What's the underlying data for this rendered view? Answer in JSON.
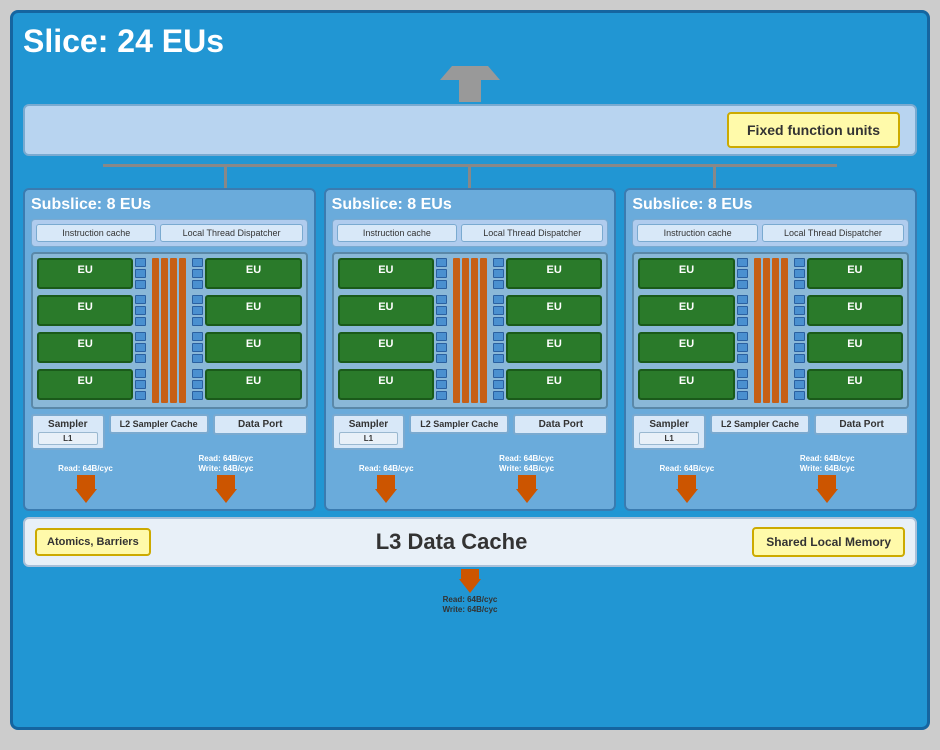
{
  "title": "Slice: 24 EUs",
  "fixed_function_units": "Fixed function units",
  "subslices": [
    {
      "title": "Subslice: 8 EUs",
      "instr_cache": "Instruction cache",
      "thread_dispatcher": "Local Thread Dispatcher",
      "eu_label": "EU",
      "sampler": "Sampler",
      "sampler_l1": "L1",
      "l2_sampler": "L2 Sampler Cache",
      "data_port": "Data Port",
      "bw_read1": "Read: 64B/cyc",
      "bw_read2": "Read: 64B/cyc",
      "bw_write2": "Write: 64B/cyc"
    },
    {
      "title": "Subslice: 8 EUs",
      "instr_cache": "Instruction cache",
      "thread_dispatcher": "Local Thread Dispatcher",
      "eu_label": "EU",
      "sampler": "Sampler",
      "sampler_l1": "L1",
      "l2_sampler": "L2 Sampler Cache",
      "data_port": "Data Port",
      "bw_read1": "Read: 64B/cyc",
      "bw_read2": "Read: 64B/cyc",
      "bw_write2": "Write: 64B/cyc"
    },
    {
      "title": "Subslice: 8 EUs",
      "instr_cache": "Instruction cache",
      "thread_dispatcher": "Local Thread Dispatcher",
      "eu_label": "EU",
      "sampler": "Sampler",
      "sampler_l1": "L1",
      "l2_sampler": "L2 Sampler Cache",
      "data_port": "Data Port",
      "bw_read1": "Read: 64B/cyc",
      "bw_read2": "Read: 64B/cyc",
      "bw_write2": "Write: 64B/cyc"
    }
  ],
  "l3_label": "L3 Data Cache",
  "atomics_label": "Atomics, Barriers",
  "slm_label": "Shared Local Memory",
  "bottom_bw_read": "Read: 64B/cyc",
  "bottom_bw_write": "Write: 64B/cyc"
}
